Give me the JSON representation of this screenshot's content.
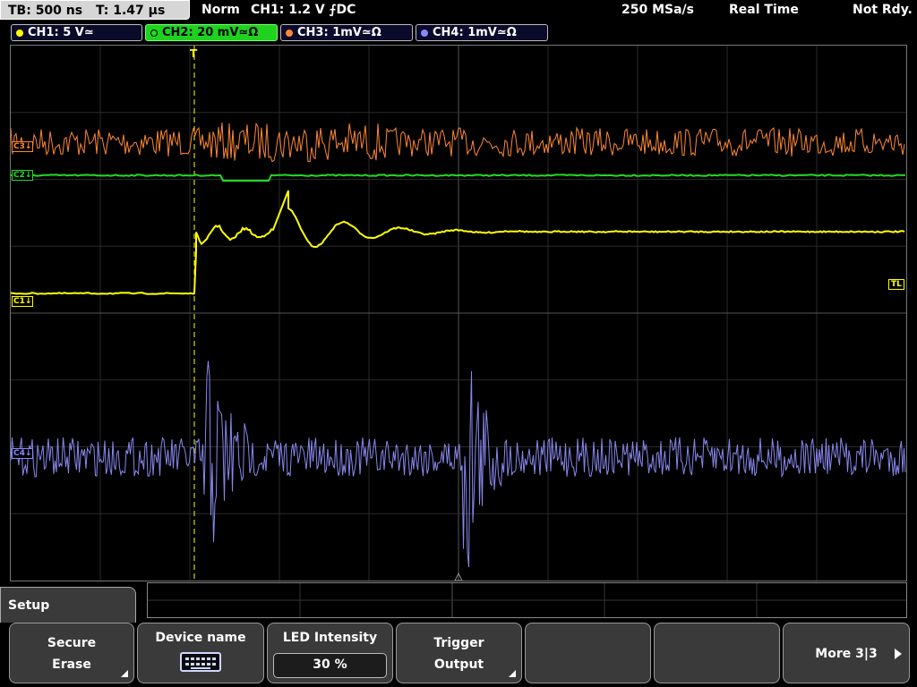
{
  "status": {
    "timebase": "TB: 500 ns",
    "trigger_time": "T: 1.47 µs",
    "mode": "Norm",
    "trigger_info": "CH1: 1.2 V ⨍DC",
    "sample_rate": "250 MSa/s",
    "acq_mode": "Real Time",
    "ready_state": "Not Rdy."
  },
  "channels": [
    {
      "label": "CH1: 5 V≃",
      "color": "#ffff00"
    },
    {
      "label": "CH2: 20 mV≃Ω",
      "color": "#22dd22"
    },
    {
      "label": "CH3: 1mV≃Ω",
      "color": "#ff8833"
    },
    {
      "label": "CH4: 1mV≃Ω",
      "color": "#8888ff"
    }
  ],
  "markers": {
    "ch3": "C3↓",
    "ch2": "C2↓",
    "ch1": "C1↓",
    "ch4": "C4↓",
    "trigger_level": "TL",
    "trigger_pos": "T"
  },
  "menu": {
    "title": "Setup",
    "keys": [
      {
        "line1": "Secure",
        "line2": "Erase"
      },
      {
        "line1": "Device name",
        "icon": "keyboard-icon"
      },
      {
        "line1": "LED Intensity",
        "value": "30 %"
      },
      {
        "line1": "Trigger",
        "line2": "Output"
      },
      {
        "line1": ""
      },
      {
        "line1": ""
      },
      {
        "line1": "More 3|3"
      }
    ]
  }
}
